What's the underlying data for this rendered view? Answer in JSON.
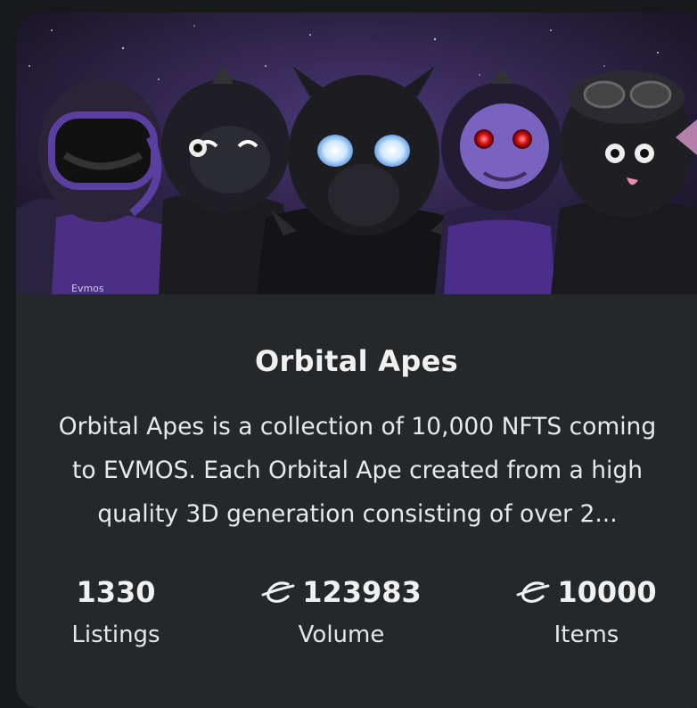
{
  "collection": {
    "title": "Orbital Apes",
    "description_lines": [
      "Orbital Apes is a collection of 10,000 NFTS coming",
      "to EVMOS. Each Orbital Ape created from a high",
      "quality 3D generation consisting of over 2..."
    ],
    "banner_badge_text": "Evmos",
    "banner_icon": "ape-characters-banner-image"
  },
  "stats": {
    "listings": {
      "value": "1330",
      "label": "Listings"
    },
    "volume": {
      "value": "123983",
      "label": "Volume",
      "icon": "evmos-coin-icon"
    },
    "items": {
      "value": "10000",
      "label": "Items",
      "icon": "evmos-coin-icon"
    }
  },
  "colors": {
    "page_bg": "#17191b",
    "card_bg": "#24282b",
    "accent_purple": "#5b2fa0",
    "text": "#f1f1f1"
  }
}
